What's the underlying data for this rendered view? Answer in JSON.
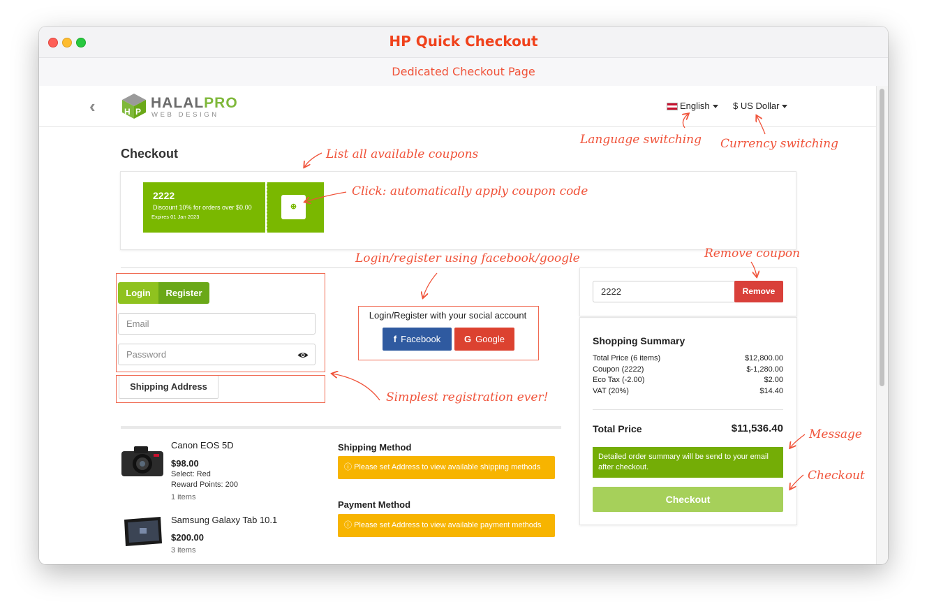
{
  "window": {
    "title": "HP Quick Checkout",
    "tab_title": "Dedicated Checkout Page"
  },
  "header": {
    "logo_brand_a": "HALAL",
    "logo_brand_b": "PRO",
    "logo_sub": "WEB DESIGN",
    "language": "English",
    "currency": "$ US Dollar"
  },
  "page": {
    "title": "Checkout"
  },
  "coupon": {
    "code": "2222",
    "description": "Discount 10% for orders over $0.00",
    "expires": "Expires 01 Jan 2023"
  },
  "auth": {
    "login_tab": "Login",
    "register_tab": "Register",
    "email_placeholder": "Email",
    "password_placeholder": "Password",
    "shipping_button": "Shipping Address"
  },
  "social": {
    "label": "Login/Register with your social account",
    "facebook": "Facebook",
    "google": "Google"
  },
  "products": [
    {
      "name": "Canon EOS 5D",
      "price": "$98.00",
      "option": "Select: Red",
      "reward": "Reward Points: 200",
      "qty": "1 items"
    },
    {
      "name": "Samsung Galaxy Tab 10.1",
      "price": "$200.00",
      "qty": "3 items"
    }
  ],
  "shipping": {
    "title": "Shipping Method",
    "notice": "Please set Address to view available shipping methods"
  },
  "payment": {
    "title": "Payment Method",
    "notice": "Please set Address to view available payment methods"
  },
  "coupon_input": {
    "value": "2222",
    "remove_label": "Remove"
  },
  "summary": {
    "title": "Shopping Summary",
    "rows": [
      {
        "label": "Total Price (6 items)",
        "value": "$12,800.00"
      },
      {
        "label": "Coupon (2222)",
        "value": "$-1,280.00"
      },
      {
        "label": "Eco Tax (-2.00)",
        "value": "$2.00"
      },
      {
        "label": "VAT (20%)",
        "value": "$14.40"
      }
    ],
    "total_label": "Total Price",
    "total_value": "$11,536.40",
    "message": "Detailed order summary will be send to your email after checkout.",
    "checkout_label": "Checkout"
  },
  "annotations": {
    "coupons": "List all available coupons",
    "apply": "Click: automatically apply coupon code",
    "language": "Language switching",
    "currency": "Currency switching",
    "social": "Login/register using facebook/google",
    "remove": "Remove coupon",
    "registration": "Simplest registration ever!",
    "message": "Message",
    "checkout": "Checkout"
  },
  "colors": {
    "accent_green": "#7ab800",
    "register_green": "#6aa818",
    "checkout_green": "#a6d05a",
    "warning_yellow": "#f7b400",
    "remove_red": "#d9403a",
    "facebook_blue": "#2f5aa0",
    "google_red": "#dc4230",
    "annotation_red": "#f0533a",
    "title_red": "#f0421c"
  }
}
